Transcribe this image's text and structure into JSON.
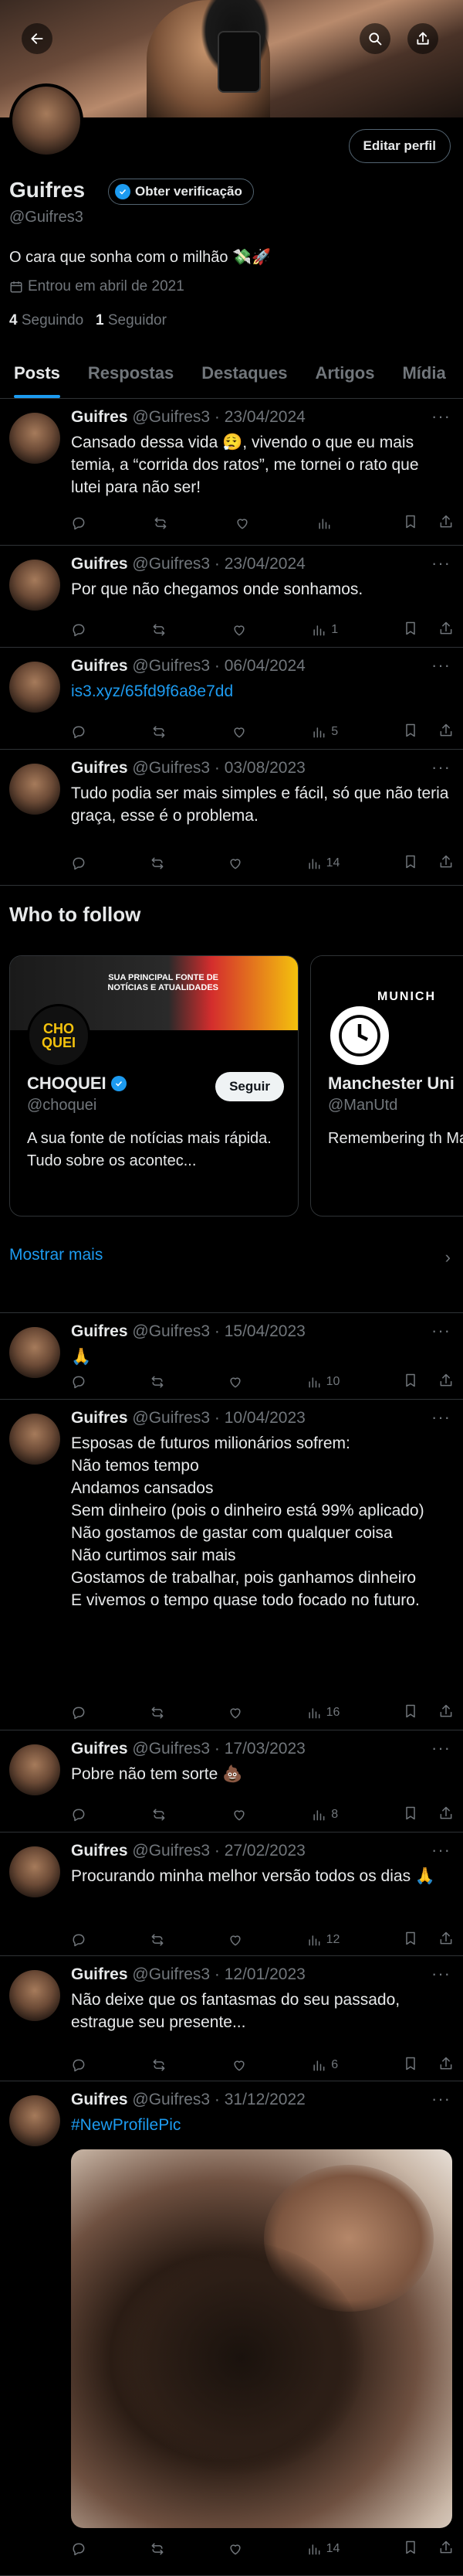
{
  "profile": {
    "edit_label": "Editar perfil",
    "name": "Guifres",
    "verify_label": "Obter verificação",
    "handle": "@Guifres3",
    "bio": "O cara que sonha com o milhão 💸🚀",
    "joined": "Entrou em abril de 2021",
    "following_count": "4",
    "following_label": "Seguindo",
    "followers_count": "1",
    "followers_label": "Seguidor"
  },
  "tabs": [
    "Posts",
    "Respostas",
    "Destaques",
    "Artigos",
    "Mídia"
  ],
  "tweets": [
    {
      "name": "Guifres",
      "meta": "@Guifres3 · 23/04/2024",
      "text": "Cansado dessa vida 😮‍💨, vivendo o que eu mais temia, a “corrida dos ratos”, me tornei o rato que lutei para não ser!",
      "views": ""
    },
    {
      "name": "Guifres",
      "meta": "@Guifres3 · 23/04/2024",
      "text": "Por que não chegamos onde sonhamos.",
      "views": "1"
    },
    {
      "name": "Guifres",
      "meta": "@Guifres3 · 06/04/2024",
      "text": "is3.xyz/65fd9f6a8e7dd",
      "views": "5"
    },
    {
      "name": "Guifres",
      "meta": "@Guifres3 · 03/08/2023",
      "text": "Tudo podia ser mais simples e fácil, só que não teria graça, esse é o problema.",
      "views": "14"
    },
    {
      "name": "Guifres",
      "meta": "@Guifres3 · 15/04/2023",
      "text": "🙏",
      "views": "10"
    },
    {
      "name": "Guifres",
      "meta": "@Guifres3 · 10/04/2023",
      "text": "Esposas de futuros milionários sofrem:\nNão temos tempo\nAndamos cansados\nSem dinheiro (pois o dinheiro está 99% aplicado)\nNão gostamos de gastar com qualquer coisa\nNão curtimos sair mais\nGostamos de trabalhar, pois ganhamos dinheiro\nE vivemos o tempo quase todo focado no futuro.",
      "views": "16"
    },
    {
      "name": "Guifres",
      "meta": "@Guifres3 · 17/03/2023",
      "text": "Pobre não tem sorte 💩",
      "views": "8"
    },
    {
      "name": "Guifres",
      "meta": "@Guifres3 · 27/02/2023",
      "text": "Procurando minha melhor versão todos os dias 🙏",
      "views": "12"
    },
    {
      "name": "Guifres",
      "meta": "@Guifres3 · 12/01/2023",
      "text": "Não deixe que os fantasmas do seu passado, estrague seu presente...",
      "views": "6"
    },
    {
      "name": "Guifres",
      "meta": "@Guifres3 · 31/12/2022",
      "text": "#NewProfilePic",
      "views": "14"
    }
  ],
  "who_to_follow": {
    "title": "Who to follow",
    "show_more": "Mostrar mais",
    "cards": [
      {
        "name": "CHOQUEI",
        "handle": "@choquei",
        "desc": "A sua fonte de notícias mais rápida. Tudo sobre os acontec...",
        "follow": "Seguir",
        "cover_text": "SUA PRINCIPAL FONTE DE NOTÍCIAS E ATUALIDADES",
        "avatar_text": "CHO QUEI"
      },
      {
        "name": "Manchester Uni",
        "handle": "@ManUtd",
        "desc": "Remembering th Manchester 🌹",
        "follow": "",
        "cover_text": "MUNICH",
        "avatar_text": ""
      }
    ]
  },
  "colors": {
    "accent": "#1d9bf0",
    "background": "#000000",
    "muted": "#71767b"
  }
}
